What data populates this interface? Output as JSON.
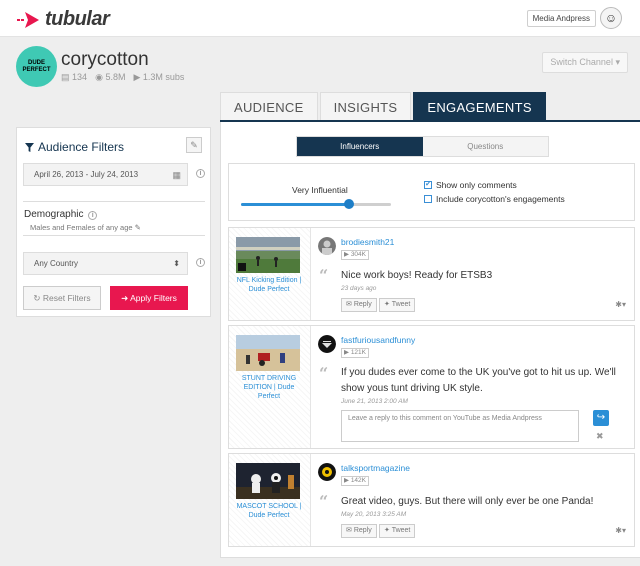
{
  "brand": {
    "name": "tubular",
    "accent": "#e8174f",
    "navy": "#153550",
    "link": "#2b8fd6"
  },
  "account": {
    "name": "Media Andpress"
  },
  "channel": {
    "name": "corycotton",
    "avatar_text": "DUDE PERFECT",
    "videos": "134",
    "views": "5.8M",
    "subs": "1.3M subs",
    "switch_label": "Switch Channel"
  },
  "tabs": [
    {
      "label": "AUDIENCE"
    },
    {
      "label": "INSIGHTS"
    },
    {
      "label": "ENGAGEMENTS",
      "active": true
    }
  ],
  "filters": {
    "title": "Audience Filters",
    "date_range": "April 26, 2013 - July 24, 2013",
    "demographic_label": "Demographic",
    "demographic_value": "Males and Females of any age",
    "country": "Any Country",
    "reset_label": "Reset Filters",
    "apply_label": "Apply Filters"
  },
  "engagements": {
    "toggle": [
      {
        "label": "Influencers",
        "active": true
      },
      {
        "label": "Questions"
      }
    ],
    "influence_label": "Very Influential",
    "influence_level": 0.72,
    "show_only_comments": {
      "label": "Show only comments",
      "checked": true
    },
    "include_own": {
      "label": "Include corycotton's engagements",
      "checked": false
    }
  },
  "comments": [
    {
      "video_title": "NFL Kicking Edition | Dude Perfect",
      "user": "brodiesmith21",
      "subs": "304K",
      "text": "Nice work boys! Ready for ETSB3",
      "date": "23 days ago",
      "reply_label": "Reply",
      "tweet_label": "Tweet"
    },
    {
      "video_title": "STUNT DRIVING EDITION | Dude Perfect",
      "user": "fastfuriousandfunny",
      "subs": "121K",
      "text": "If you dudes ever come to the UK you've got to hit us up. We'll show yous tunt driving UK style.",
      "date": "June 21, 2013 2:00 AM",
      "reply_placeholder": "Leave a reply to this comment on YouTube as Media Andpress"
    },
    {
      "video_title": "MASCOT SCHOOL | Dude Perfect",
      "user": "talksportmagazine",
      "subs": "142K",
      "text": "Great video, guys. But there will only ever be one Panda!",
      "date": "May 20, 2013 3:25 AM",
      "reply_label": "Reply",
      "tweet_label": "Tweet"
    }
  ],
  "icons": {
    "filter": "filter-icon",
    "pin": "pin-icon",
    "calendar": "calendar-icon",
    "info": "info-icon",
    "pencil": "pencil-icon",
    "film": "film-icon",
    "eye": "eye-icon",
    "play": "play-icon",
    "reply": "reply-icon",
    "twitter": "twitter-icon",
    "gear": "gear-icon",
    "share": "share-icon",
    "close": "close-icon"
  }
}
